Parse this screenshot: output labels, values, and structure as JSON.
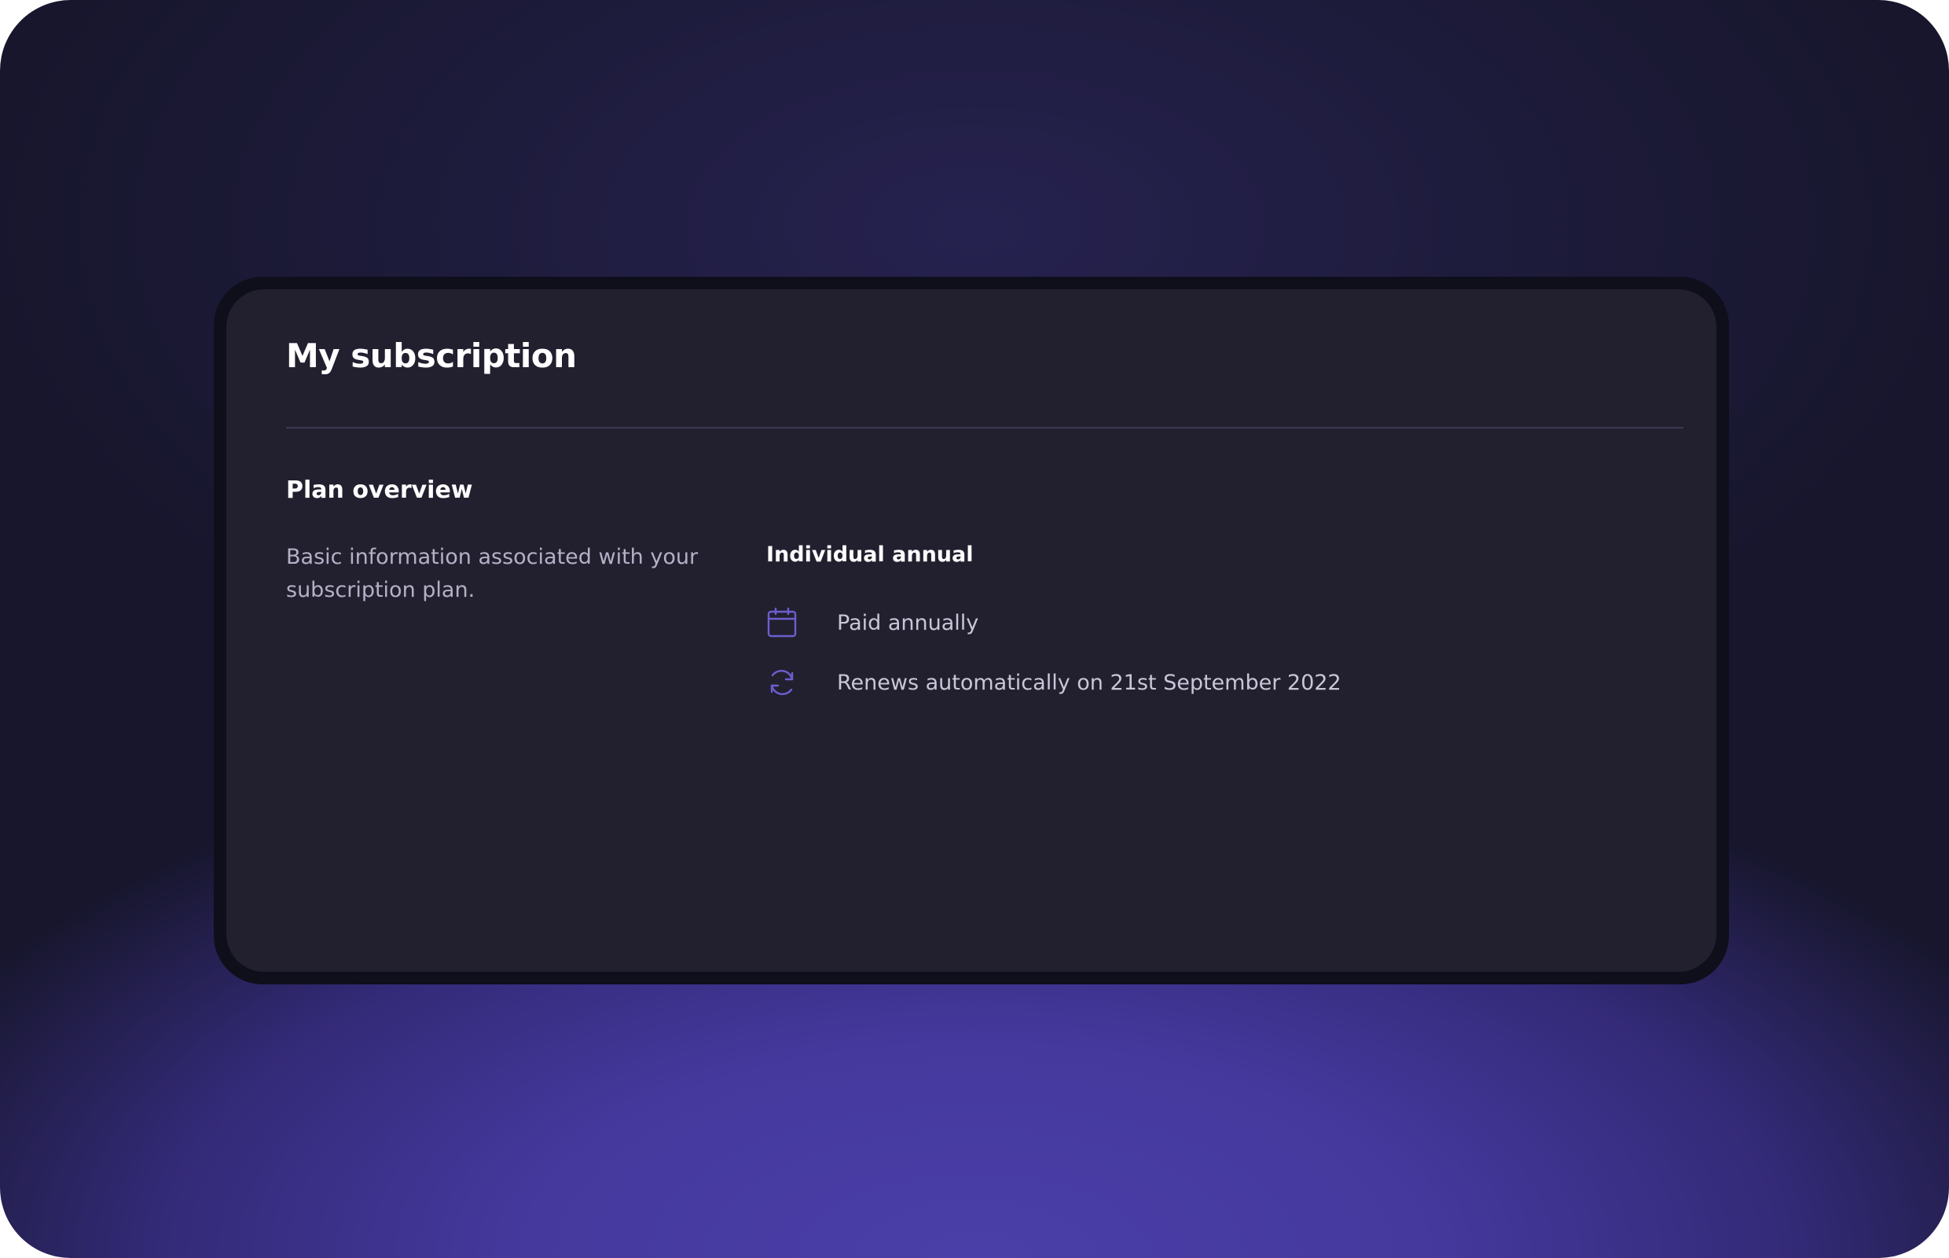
{
  "card": {
    "title": "My subscription"
  },
  "plan_overview": {
    "heading": "Plan overview",
    "description": "Basic information associated with your subscription plan.",
    "plan_name": "Individual annual",
    "details": [
      {
        "icon": "calendar-icon",
        "text": "Paid annually"
      },
      {
        "icon": "refresh-icon",
        "text": "Renews automatically on 21st September 2022"
      }
    ]
  },
  "colors": {
    "accent": "#6b5fd0",
    "card_background": "#22202f",
    "card_border": "#0f0e1b",
    "page_gradient_bottom": "#4a3fa8",
    "page_gradient_top": "#17162c"
  }
}
